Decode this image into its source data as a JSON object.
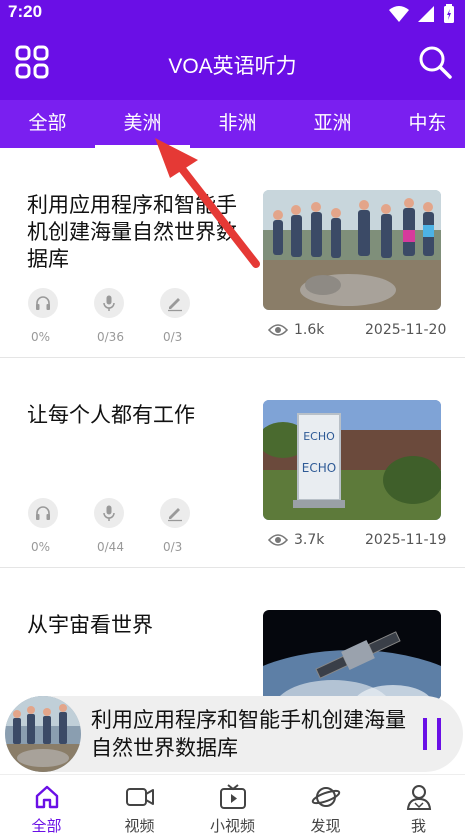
{
  "status_bar": {
    "time": "7:20"
  },
  "app_bar": {
    "title": "VOA英语听力"
  },
  "tabs": [
    {
      "label": "全部",
      "active": false
    },
    {
      "label": "美洲",
      "active": true
    },
    {
      "label": "非洲",
      "active": false
    },
    {
      "label": "亚洲",
      "active": false
    },
    {
      "label": "中东",
      "active": false
    }
  ],
  "articles": [
    {
      "title": "利用应用程序和智能手机创建海量自然世界数据库",
      "listen": "0%",
      "speak": "0/36",
      "write": "0/3",
      "views": "1.6k",
      "date": "2025-11-20"
    },
    {
      "title": "让每个人都有工作",
      "listen": "0%",
      "speak": "0/44",
      "write": "0/3",
      "views": "3.7k",
      "date": "2025-11-19"
    },
    {
      "title": "从宇宙看世界"
    }
  ],
  "player": {
    "title": "利用应用程序和智能手机创建海量自然世界数据库"
  },
  "bottom_nav": [
    {
      "label": "全部",
      "icon": "home-icon",
      "active": true
    },
    {
      "label": "视频",
      "icon": "video-camera-icon",
      "active": false
    },
    {
      "label": "小视频",
      "icon": "tv-play-icon",
      "active": false
    },
    {
      "label": "发现",
      "icon": "planet-icon",
      "active": false
    },
    {
      "label": "我",
      "icon": "user-icon",
      "active": false
    }
  ],
  "colors": {
    "primary": "#6A0FE6",
    "tab_bar": "#7A1FF0",
    "annotation_arrow": "#E53935"
  }
}
